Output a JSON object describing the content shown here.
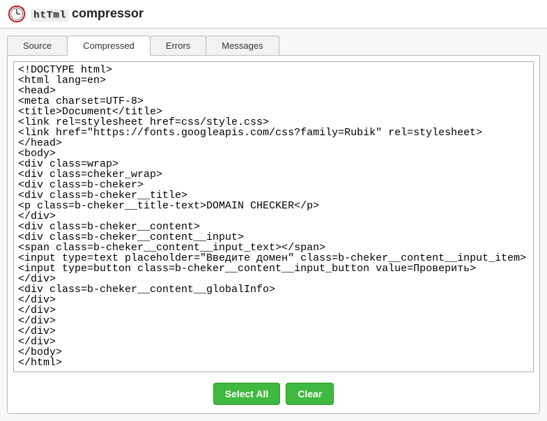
{
  "header": {
    "logo_html": "htTml",
    "logo_compressor": "compressor"
  },
  "tabs": [
    {
      "label": "Source",
      "active": false
    },
    {
      "label": "Compressed",
      "active": true
    },
    {
      "label": "Errors",
      "active": false
    },
    {
      "label": "Messages",
      "active": false
    }
  ],
  "code": "<!DOCTYPE html>\n<html lang=en>\n<head>\n<meta charset=UTF-8>\n<title>Document</title>\n<link rel=stylesheet href=css/style.css>\n<link href=\"https://fonts.googleapis.com/css?family=Rubik\" rel=stylesheet>\n</head>\n<body>\n<div class=wrap>\n<div class=cheker_wrap>\n<div class=b-cheker>\n<div class=b-cheker__title>\n<p class=b-cheker__title-text>DOMAIN CHECKER</p>\n</div>\n<div class=b-cheker__content>\n<div class=b-cheker__content__input>\n<span class=b-cheker__content__input_text></span>\n<input type=text placeholder=\"Введите домен\" class=b-cheker__content__input_item>\n<input type=button class=b-cheker__content__input_button value=Проверить>\n</div>\n<div class=b-cheker__content__globalInfo>\n</div>\n</div>\n</div>\n</div>\n</div>\n</body>\n</html>",
  "buttons": {
    "select_all": "Select All",
    "clear": "Clear"
  }
}
